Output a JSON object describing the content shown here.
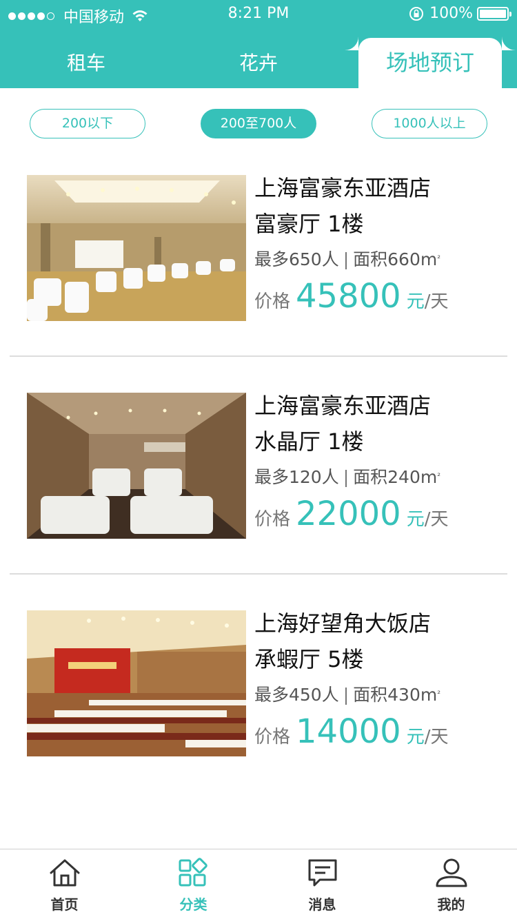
{
  "status_bar": {
    "carrier": "中国移动",
    "time": "8:21 PM",
    "battery": "100%"
  },
  "tabs": [
    {
      "label": "租车"
    },
    {
      "label": "花卉"
    },
    {
      "label": "场地预订"
    }
  ],
  "filters": [
    {
      "label": "200以下"
    },
    {
      "label": "200至700人"
    },
    {
      "label": "1000人以上"
    }
  ],
  "venues": [
    {
      "name": "上海富豪东亚酒店",
      "hall": "富豪厅 1楼",
      "capacity": "最多650人",
      "area": "面积660m",
      "area_sup": "²",
      "price_label": "价格",
      "price": "45800",
      "unit_yuan": "元",
      "unit_day": "/天"
    },
    {
      "name": "上海富豪东亚酒店",
      "hall": "水晶厅 1楼",
      "capacity": "最多120人",
      "area": "面积240m",
      "area_sup": "²",
      "price_label": "价格",
      "price": "22000",
      "unit_yuan": "元",
      "unit_day": "/天"
    },
    {
      "name": "上海好望角大饭店",
      "hall": "承蝦厅 5楼",
      "capacity": "最多450人",
      "area": "面积430m",
      "area_sup": "²",
      "price_label": "价格",
      "price": "14000",
      "unit_yuan": "元",
      "unit_day": "/天"
    }
  ],
  "bottom_nav": [
    {
      "label": "首页",
      "icon": "home-icon"
    },
    {
      "label": "分类",
      "icon": "category-icon"
    },
    {
      "label": "消息",
      "icon": "message-icon"
    },
    {
      "label": "我的",
      "icon": "profile-icon"
    }
  ],
  "colors": {
    "accent": "#36c1b9",
    "text": "#111111",
    "muted": "#777777"
  }
}
